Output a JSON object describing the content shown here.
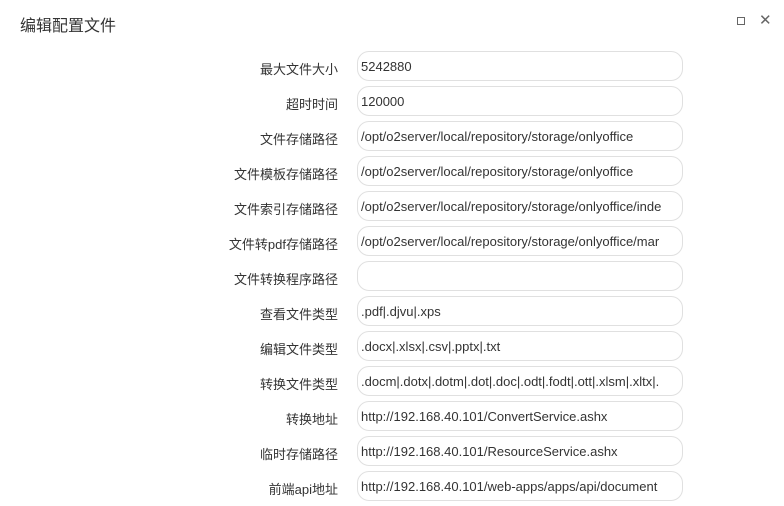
{
  "dialog": {
    "title": "编辑配置文件"
  },
  "fields": [
    {
      "label": "最大文件大小",
      "value": "5242880"
    },
    {
      "label": "超时时间",
      "value": "120000"
    },
    {
      "label": "文件存储路径",
      "value": "/opt/o2server/local/repository/storage/onlyoffice"
    },
    {
      "label": "文件模板存储路径",
      "value": "/opt/o2server/local/repository/storage/onlyoffice"
    },
    {
      "label": "文件索引存储路径",
      "value": "/opt/o2server/local/repository/storage/onlyoffice/inde"
    },
    {
      "label": "文件转pdf存储路径",
      "value": "/opt/o2server/local/repository/storage/onlyoffice/mar"
    },
    {
      "label": "文件转换程序路径",
      "value": ""
    },
    {
      "label": "查看文件类型",
      "value": ".pdf|.djvu|.xps"
    },
    {
      "label": "编辑文件类型",
      "value": ".docx|.xlsx|.csv|.pptx|.txt"
    },
    {
      "label": "转换文件类型",
      "value": ".docm|.dotx|.dotm|.dot|.doc|.odt|.fodt|.ott|.xlsm|.xltx|."
    },
    {
      "label": "转换地址",
      "value": "http://192.168.40.101/ConvertService.ashx"
    },
    {
      "label": "临时存储路径",
      "value": "http://192.168.40.101/ResourceService.ashx"
    },
    {
      "label": "前端api地址",
      "value": "http://192.168.40.101/web-apps/apps/api/document"
    }
  ]
}
